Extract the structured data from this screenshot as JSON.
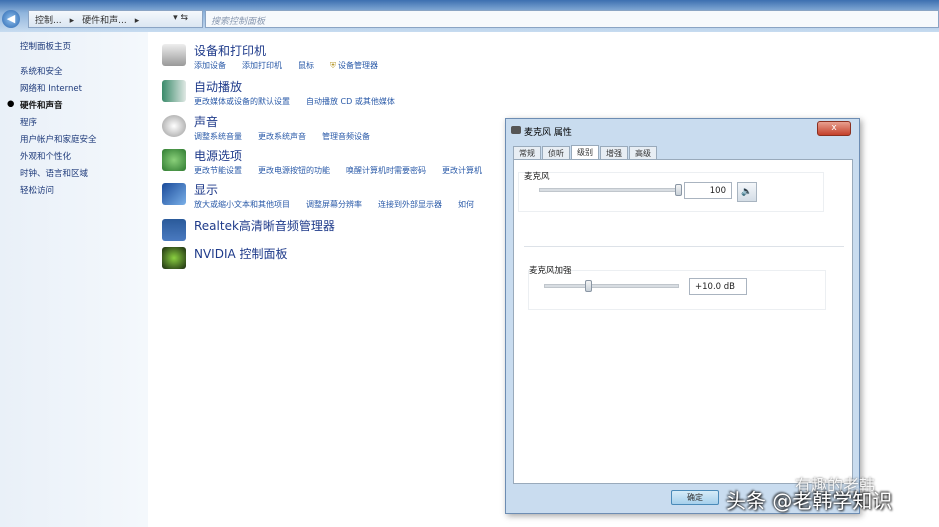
{
  "address": {
    "crumbs": [
      "控制...",
      "硬件和声..."
    ],
    "search_placeholder": "搜索控制面板"
  },
  "sidebar": {
    "home": "控制面板主页",
    "items": [
      "系统和安全",
      "网络和 Internet",
      "硬件和声音",
      "程序",
      "用户帐户和家庭安全",
      "外观和个性化",
      "时钟、语言和区域",
      "轻松访问"
    ],
    "current": "硬件和声音"
  },
  "categories": [
    {
      "title": "设备和打印机",
      "links": [
        "添加设备",
        "添加打印机",
        "鼠标",
        "设备管理器"
      ]
    },
    {
      "title": "自动播放",
      "links": [
        "更改媒体或设备的默认设置",
        "自动播放 CD 或其他媒体"
      ]
    },
    {
      "title": "声音",
      "links": [
        "调整系统音量",
        "更改系统声音",
        "管理音频设备"
      ]
    },
    {
      "title": "电源选项",
      "links": [
        "更改节能设置",
        "更改电源按钮的功能",
        "唤醒计算机时需要密码",
        "更改计算机"
      ]
    },
    {
      "title": "显示",
      "links": [
        "放大或缩小文本和其他项目",
        "调整屏幕分辨率",
        "连接到外部显示器",
        "如何"
      ]
    },
    {
      "title": "Realtek高清晰音频管理器",
      "links": []
    },
    {
      "title": "NVIDIA 控制面板",
      "links": []
    }
  ],
  "dialog": {
    "title": "麦克风 属性",
    "close": "x",
    "tabs": [
      "常规",
      "侦听",
      "级别",
      "增强",
      "高级"
    ],
    "active_tab": "级别",
    "mic_label": "麦克风",
    "mic_value": "100",
    "mic_level_percent": 100,
    "boost_label": "麦克风加强",
    "boost_value": "+10.0 dB",
    "boost_level_fraction": 0.33,
    "ok": "确定"
  },
  "watermark": {
    "line1": "有趣的老韩",
    "line2": "头条 @老韩学知识"
  },
  "colors": {
    "link": "#2a5aa8",
    "title": "#1e3a8a"
  }
}
